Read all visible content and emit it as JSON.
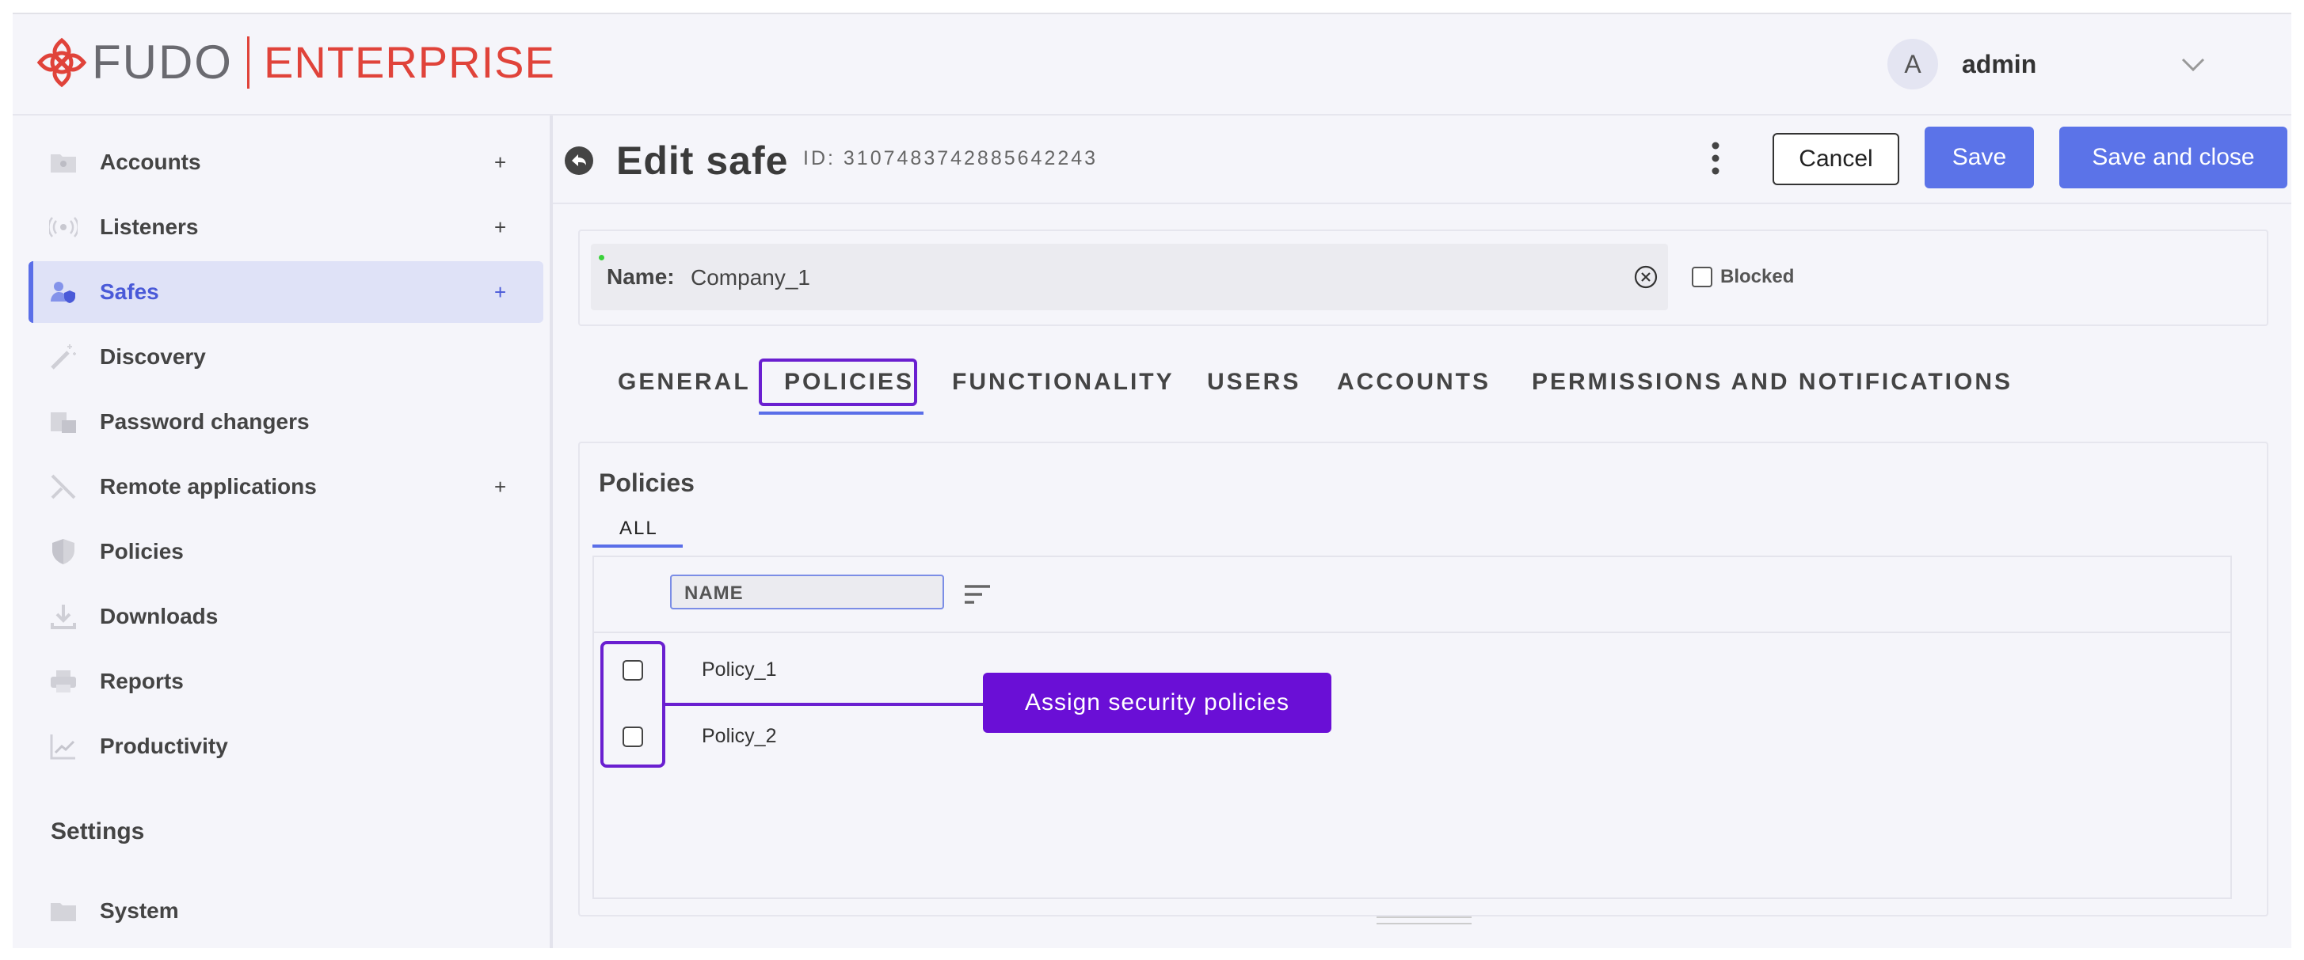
{
  "brand": {
    "name": "FUDO",
    "edition": "ENTERPRISE",
    "color": "#e0433a"
  },
  "user": {
    "avatar_letter": "A",
    "name": "admin"
  },
  "sidebar": {
    "items": [
      {
        "label": "Accounts",
        "plus": "+",
        "icon": "accounts-icon"
      },
      {
        "label": "Listeners",
        "plus": "+",
        "icon": "listeners-icon"
      },
      {
        "label": "Safes",
        "plus": "+",
        "icon": "safes-icon",
        "active": true
      },
      {
        "label": "Discovery",
        "icon": "discovery-icon"
      },
      {
        "label": "Password changers",
        "icon": "password-changers-icon"
      },
      {
        "label": "Remote applications",
        "plus": "+",
        "icon": "remote-applications-icon"
      },
      {
        "label": "Policies",
        "icon": "policies-icon"
      },
      {
        "label": "Downloads",
        "icon": "downloads-icon"
      },
      {
        "label": "Reports",
        "icon": "reports-icon"
      },
      {
        "label": "Productivity",
        "icon": "productivity-icon"
      }
    ],
    "settings_heading": "Settings",
    "settings_items": [
      {
        "label": "System",
        "icon": "system-icon"
      }
    ]
  },
  "page": {
    "title": "Edit safe",
    "id_text": "ID: 3107483742885642243",
    "cancel_label": "Cancel",
    "save_label": "Save",
    "save_close_label": "Save and close"
  },
  "form": {
    "name_label": "Name:",
    "name_value": "Company_1",
    "blocked_label": "Blocked",
    "blocked_checked": false
  },
  "tabs": [
    {
      "label": "GENERAL"
    },
    {
      "label": "POLICIES",
      "active": true
    },
    {
      "label": "FUNCTIONALITY"
    },
    {
      "label": "USERS"
    },
    {
      "label": "ACCOUNTS"
    },
    {
      "label": "PERMISSIONS AND NOTIFICATIONS"
    }
  ],
  "policies": {
    "title": "Policies",
    "subtab": "ALL",
    "column_name": "NAME",
    "rows": [
      {
        "name": "Policy_1",
        "checked": false
      },
      {
        "name": "Policy_2",
        "checked": false
      }
    ],
    "callout": "Assign security policies"
  },
  "colors": {
    "accent": "#5b73e8",
    "highlight": "#6a1fd0",
    "callout_bg": "#6a0fd6"
  }
}
